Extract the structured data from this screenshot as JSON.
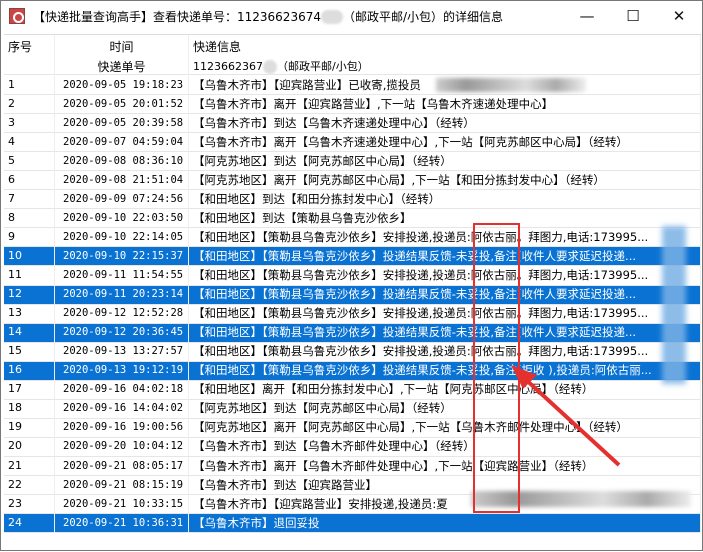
{
  "window": {
    "title_prefix": "【快递批量查询高手】查看快递单号：11236623674",
    "title_suffix": "（邮政平邮/小包）的详细信息",
    "minimize": "—",
    "maximize": "☐",
    "close": "✕"
  },
  "header": {
    "col_seq": "序号",
    "col_time": "时间",
    "col_info": "快递信息",
    "sub_label": "快递单号",
    "sub_number": "1123662367",
    "sub_company": "（邮政平邮/小包）"
  },
  "rows": [
    {
      "n": "1",
      "t": "2020-09-05 19:18:23",
      "i": "【乌鲁木齐市】【迎宾路营业】已收寄,揽投员",
      "s": false
    },
    {
      "n": "2",
      "t": "2020-09-05 20:01:52",
      "i": "【乌鲁木齐市】离开【迎宾路营业】,下一站【乌鲁木齐速递处理中心】",
      "s": false
    },
    {
      "n": "3",
      "t": "2020-09-05 20:39:58",
      "i": "【乌鲁木齐市】到达【乌鲁木齐速递处理中心】（经转）",
      "s": false
    },
    {
      "n": "4",
      "t": "2020-09-07 04:59:04",
      "i": "【乌鲁木齐市】离开【乌鲁木齐速递处理中心】,下一站【阿克苏邮区中心局】（经转）",
      "s": false
    },
    {
      "n": "5",
      "t": "2020-09-08 08:36:10",
      "i": "【阿克苏地区】到达【阿克苏邮区中心局】（经转）",
      "s": false
    },
    {
      "n": "6",
      "t": "2020-09-08 21:51:04",
      "i": "【阿克苏地区】离开【阿克苏邮区中心局】,下一站【和田分拣封发中心】（经转）",
      "s": false
    },
    {
      "n": "7",
      "t": "2020-09-09 07:24:56",
      "i": "【和田地区】到达【和田分拣封发中心】（经转）",
      "s": false
    },
    {
      "n": "8",
      "t": "2020-09-10 22:03:50",
      "i": "【和田地区】到达【策勒县乌鲁克沙依乡】",
      "s": false
    },
    {
      "n": "9",
      "t": "2020-09-10 22:14:05",
      "i": "【和田地区】【策勒县乌鲁克沙依乡】安排投递,投递员:阿依古丽。拜图力,电话:173995...",
      "s": false
    },
    {
      "n": "10",
      "t": "2020-09-10 22:15:37",
      "i": "【和田地区】【策勒县乌鲁克沙依乡】投递结果反馈-未妥投,备注(收件人要求延迟投递...",
      "s": true
    },
    {
      "n": "11",
      "t": "2020-09-11 11:54:55",
      "i": "【和田地区】【策勒县乌鲁克沙依乡】安排投递,投递员:阿依古丽。拜图力,电话:173995...",
      "s": false
    },
    {
      "n": "12",
      "t": "2020-09-11 20:23:14",
      "i": "【和田地区】【策勒县乌鲁克沙依乡】投递结果反馈-未妥投,备注(收件人要求延迟投递...",
      "s": true
    },
    {
      "n": "13",
      "t": "2020-09-12 12:52:28",
      "i": "【和田地区】【策勒县乌鲁克沙依乡】安排投递,投递员:阿依古丽。拜图力,电话:173995...",
      "s": false
    },
    {
      "n": "14",
      "t": "2020-09-12 20:36:45",
      "i": "【和田地区】【策勒县乌鲁克沙依乡】投递结果反馈-未妥投,备注(收件人要求延迟投递...",
      "s": true
    },
    {
      "n": "15",
      "t": "2020-09-13 13:27:57",
      "i": "【和田地区】【策勒县乌鲁克沙依乡】安排投递,投递员:阿依古丽。拜图力,电话:173995...",
      "s": false
    },
    {
      "n": "16",
      "t": "2020-09-13 19:12:19",
      "i": "【和田地区】【策勒县乌鲁克沙依乡】投递结果反馈-未妥投,备注(拒收 ),投递员:阿依古丽...",
      "s": true
    },
    {
      "n": "17",
      "t": "2020-09-16 04:02:18",
      "i": "【和田地区】离开【和田分拣封发中心】,下一站【阿克苏邮区中心局】（经转）",
      "s": false
    },
    {
      "n": "18",
      "t": "2020-09-16 14:04:02",
      "i": "【阿克苏地区】到达【阿克苏邮区中心局】（经转）",
      "s": false
    },
    {
      "n": "19",
      "t": "2020-09-16 19:00:56",
      "i": "【阿克苏地区】离开【阿克苏邮区中心局】,下一站【乌鲁木齐邮件处理中心】（经转）",
      "s": false
    },
    {
      "n": "20",
      "t": "2020-09-20 10:04:12",
      "i": "【乌鲁木齐市】到达【乌鲁木齐邮件处理中心】（经转）",
      "s": false
    },
    {
      "n": "21",
      "t": "2020-09-21 08:05:17",
      "i": "【乌鲁木齐市】离开【乌鲁木齐邮件处理中心】,下一站【迎宾路营业】（经转）",
      "s": false
    },
    {
      "n": "22",
      "t": "2020-09-21 08:15:19",
      "i": "【乌鲁木齐市】到达【迎宾路营业】",
      "s": false
    },
    {
      "n": "23",
      "t": "2020-09-21 10:33:15",
      "i": "【乌鲁木齐市】【迎宾路营业】安排投递,投递员:夏",
      "s": false
    },
    {
      "n": "24",
      "t": "2020-09-21 10:36:31",
      "i": "【乌鲁木齐市】退回妥投",
      "s": true
    }
  ]
}
